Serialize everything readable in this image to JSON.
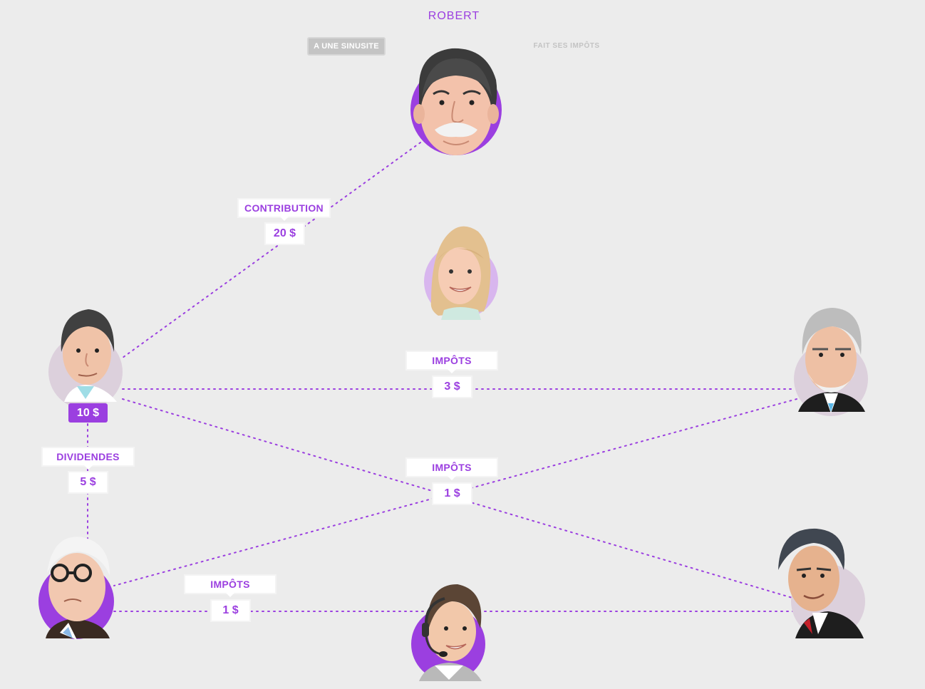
{
  "header": {
    "title": "ROBERT",
    "state_button": "A UNE SINUSITE",
    "state_link": "FAIT SES IMPÔTS"
  },
  "colors": {
    "accent": "#9b3fe0",
    "accent_light": "#d8b6ee",
    "ring_neutral": "#dcd0dc",
    "background": "#ececec"
  },
  "balance": "10 $",
  "flows": [
    {
      "label": "CONTRIBUTION",
      "amount": "20 $"
    },
    {
      "label": "IMPÔTS",
      "amount": "3 $"
    },
    {
      "label": "DIVIDENDES",
      "amount": "5 $"
    },
    {
      "label": "IMPÔTS",
      "amount": "1 $"
    },
    {
      "label": "IMPÔTS",
      "amount": "1 $"
    }
  ]
}
